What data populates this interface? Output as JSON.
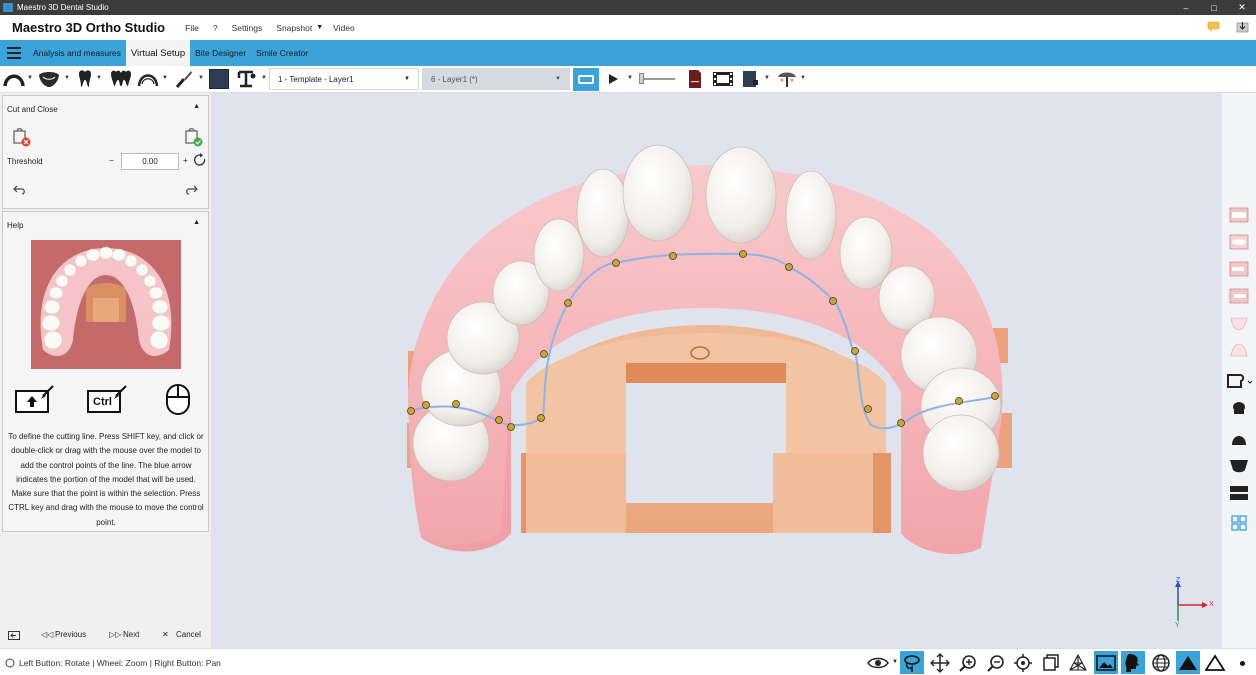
{
  "window": {
    "title": "Maestro 3D Dental Studio",
    "controls": [
      "–",
      "□",
      "✕"
    ]
  },
  "menu": {
    "app_name": "Maestro 3D Ortho Studio",
    "file": "File",
    "help": "?",
    "settings": "Settings",
    "snapshot": "Snapshot",
    "video": "Video"
  },
  "tabs": [
    "Analysis and measures",
    "Virtual Setup",
    "Bite Designer",
    "Smile Creator"
  ],
  "active_tab": "Virtual Setup",
  "toolbar": {
    "template_combo": "1 - Template - Layer1",
    "layer_combo": "6 - Layer1 (*)"
  },
  "cut_panel": {
    "title": "Cut and Close",
    "threshold_label": "Threshold",
    "threshold_value": "0.00",
    "minus": "−",
    "plus": "+"
  },
  "help_panel": {
    "title": "Help",
    "text": "To define the cutting line. Press SHIFT key, and click or double-click or drag with the mouse over the model to add the control points of the line. The blue arrow indicates the portion of the model that will be used. Make sure that the point is within the selection. Press CTRL key and drag with the mouse to move the control point.",
    "ctrl_key": "Ctrl"
  },
  "wizard": {
    "previous": "Previous",
    "next": "Next",
    "cancel": "Cancel"
  },
  "axes": {
    "x": "X",
    "y": "Y",
    "z": "Z"
  },
  "status": {
    "text": "Left Button: Rotate | Wheel: Zoom | Right Button: Pan"
  },
  "colors": {
    "accent": "#3ba3d7",
    "gingiva": "#f4a7ad",
    "base": "#eeb38e",
    "teeth": "#f4f2ee",
    "spline": "#8fb3e8",
    "control_point": "#c9a53a"
  }
}
